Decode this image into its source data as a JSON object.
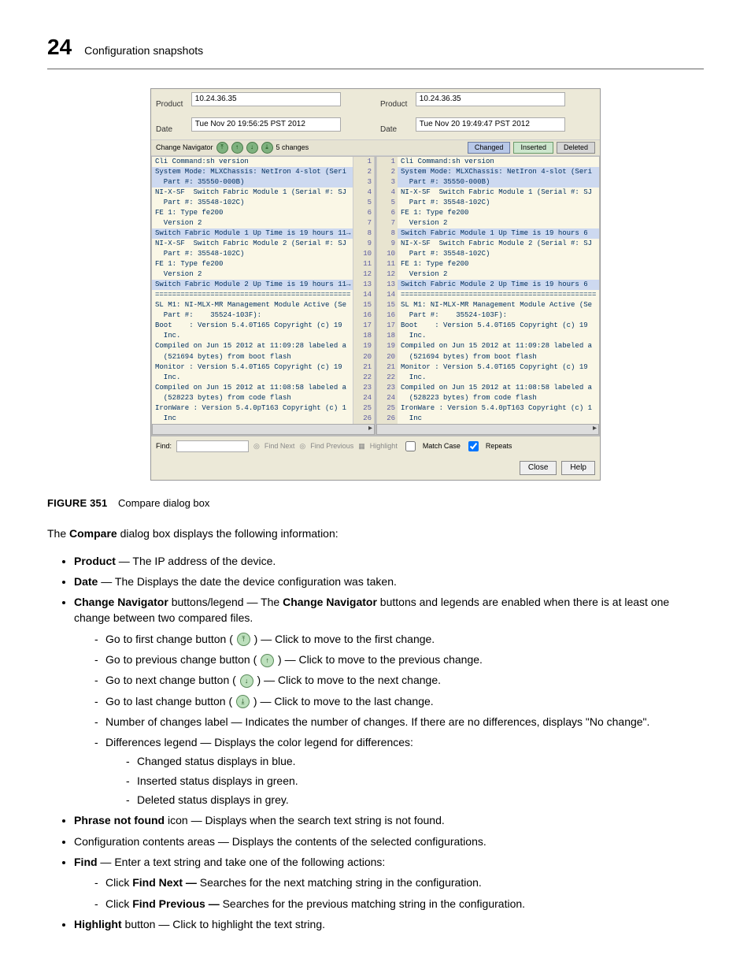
{
  "header": {
    "page_number": "24",
    "section": "Configuration snapshots"
  },
  "dialog": {
    "left": {
      "product_label": "Product",
      "product": "10.24.36.35",
      "date_label": "Date",
      "date": "Tue Nov 20 19:56:25 PST 2012"
    },
    "right": {
      "product_label": "Product",
      "product": "10.24.36.35",
      "date_label": "Date",
      "date": "Tue Nov 20 19:49:47 PST 2012"
    },
    "nav_label": "Change Navigator",
    "changes_label": "5 changes",
    "legend": {
      "changed": "Changed",
      "inserted": "Inserted",
      "deleted": "Deleted"
    },
    "lines_left": [
      {
        "t": "Cli Command:sh version",
        "c": false
      },
      {
        "t": "System Mode: MLXChassis: NetIron 4-slot (Seri",
        "c": true
      },
      {
        "t": "  Part #: 35550-000B)",
        "c": true
      },
      {
        "t": "NI-X-SF  Switch Fabric Module 1 (Serial #: SJ",
        "c": false
      },
      {
        "t": "  Part #: 35548-102C)",
        "c": false
      },
      {
        "t": "FE 1: Type fe200",
        "c": false
      },
      {
        "t": "  Version 2",
        "c": false
      },
      {
        "t": "Switch Fabric Module 1 Up Time is 19 hours 11→",
        "c": true
      },
      {
        "t": "NI-X-SF  Switch Fabric Module 2 (Serial #: SJ",
        "c": false
      },
      {
        "t": "  Part #: 35548-102C)",
        "c": false
      },
      {
        "t": "FE 1: Type fe200",
        "c": false
      },
      {
        "t": "  Version 2",
        "c": false
      },
      {
        "t": "Switch Fabric Module 2 Up Time is 19 hours 11→",
        "c": true
      },
      {
        "t": "==============================================",
        "c": false
      },
      {
        "t": "SL M1: NI-MLX-MR Management Module Active (Se",
        "c": false
      },
      {
        "t": "  Part #:    35524-103F):",
        "c": false
      },
      {
        "t": "Boot    : Version 5.4.0T165 Copyright (c) 19",
        "c": false
      },
      {
        "t": "  Inc.",
        "c": false
      },
      {
        "t": "Compiled on Jun 15 2012 at 11:09:28 labeled a",
        "c": false
      },
      {
        "t": "  (521694 bytes) from boot flash",
        "c": false
      },
      {
        "t": "Monitor : Version 5.4.0T165 Copyright (c) 19",
        "c": false
      },
      {
        "t": "  Inc.",
        "c": false
      },
      {
        "t": "Compiled on Jun 15 2012 at 11:08:58 labeled a",
        "c": false
      },
      {
        "t": "  (528223 bytes) from code flash",
        "c": false
      },
      {
        "t": "IronWare : Version 5.4.0pT163 Copyright (c) 1",
        "c": false
      },
      {
        "t": "  Inc",
        "c": false
      }
    ],
    "lines_right": [
      {
        "t": "Cli Command:sh version",
        "c": false
      },
      {
        "t": "System Mode: MLXChassis: NetIron 4-slot (Seri",
        "c": true
      },
      {
        "t": "  Part #: 35550-000B)",
        "c": true
      },
      {
        "t": "NI-X-SF  Switch Fabric Module 1 (Serial #: SJ",
        "c": false
      },
      {
        "t": "  Part #: 35548-102C)",
        "c": false
      },
      {
        "t": "FE 1: Type fe200",
        "c": false
      },
      {
        "t": "  Version 2",
        "c": false
      },
      {
        "t": "Switch Fabric Module 1 Up Time is 19 hours 6",
        "c": true
      },
      {
        "t": "NI-X-SF  Switch Fabric Module 2 (Serial #: SJ",
        "c": false
      },
      {
        "t": "  Part #: 35548-102C)",
        "c": false
      },
      {
        "t": "FE 1: Type fe200",
        "c": false
      },
      {
        "t": "  Version 2",
        "c": false
      },
      {
        "t": "Switch Fabric Module 2 Up Time is 19 hours 6",
        "c": true
      },
      {
        "t": "==============================================",
        "c": false
      },
      {
        "t": "SL M1: NI-MLX-MR Management Module Active (Se",
        "c": false
      },
      {
        "t": "  Part #:    35524-103F):",
        "c": false
      },
      {
        "t": "Boot    : Version 5.4.0T165 Copyright (c) 19",
        "c": false
      },
      {
        "t": "  Inc.",
        "c": false
      },
      {
        "t": "Compiled on Jun 15 2012 at 11:09:28 labeled a",
        "c": false
      },
      {
        "t": "  (521694 bytes) from boot flash",
        "c": false
      },
      {
        "t": "Monitor : Version 5.4.0T165 Copyright (c) 19",
        "c": false
      },
      {
        "t": "  Inc.",
        "c": false
      },
      {
        "t": "Compiled on Jun 15 2012 at 11:08:58 labeled a",
        "c": false
      },
      {
        "t": "  (528223 bytes) from code flash",
        "c": false
      },
      {
        "t": "IronWare : Version 5.4.0pT163 Copyright (c) 1",
        "c": false
      },
      {
        "t": "  Inc",
        "c": false
      }
    ],
    "find": {
      "label": "Find:",
      "find_next": "Find Next",
      "find_prev": "Find Previous",
      "highlight": "Highlight",
      "match_case": "Match Case",
      "repeats": "Repeats"
    },
    "buttons": {
      "close": "Close",
      "help": "Help"
    }
  },
  "figure": {
    "num": "FIGURE 351",
    "title": "Compare dialog box"
  },
  "body": {
    "intro_a": "The ",
    "intro_b": "Compare",
    "intro_c": " dialog box displays the following information:",
    "items": {
      "product_b": "Product",
      "product_t": " — The IP address of the device.",
      "date_b": "Date",
      "date_t": " — The Displays the date the device configuration was taken.",
      "cn_b": "Change Navigator",
      "cn_t1": " buttons/legend — The ",
      "cn_b2": "Change Navigator",
      "cn_t2": " buttons and legends are enabled when there is at least one change between two compared files.",
      "first": "Go to first change button ( ",
      "first2": " ) — Click to move to the first change.",
      "prev": "Go to previous change button ( ",
      "prev2": " ) — Click to move to the previous change.",
      "next": "Go to next change button ( ",
      "next2": " ) — Click to move to the next change.",
      "last": "Go to last change button ( ",
      "last2": " ) — Click to move to the last change.",
      "numchg": "Number of changes label — Indicates the number of changes. If there are no differences, displays \"No change\".",
      "diffleg": "Differences legend — Displays the color legend for differences:",
      "leg_c": "Changed status displays in blue.",
      "leg_i": "Inserted status displays in green.",
      "leg_d": "Deleted status displays in grey.",
      "pnf_b": "Phrase not found",
      "pnf_t": " icon — Displays when the search text string is not found.",
      "cca": "Configuration contents areas — Displays the contents of the selected configurations.",
      "find_b": "Find",
      "find_t": " — Enter a text string and take one of the following actions:",
      "fn_a": "Click ",
      "fn_b": "Find Next — ",
      "fn_c": "Searches for the next matching string in the configuration.",
      "fp_a": "Click ",
      "fp_b": "Find Previous — ",
      "fp_c": "Searches for the previous matching string in the configuration.",
      "hl_b": "Highlight",
      "hl_t": " button — Click to highlight the text string."
    }
  }
}
